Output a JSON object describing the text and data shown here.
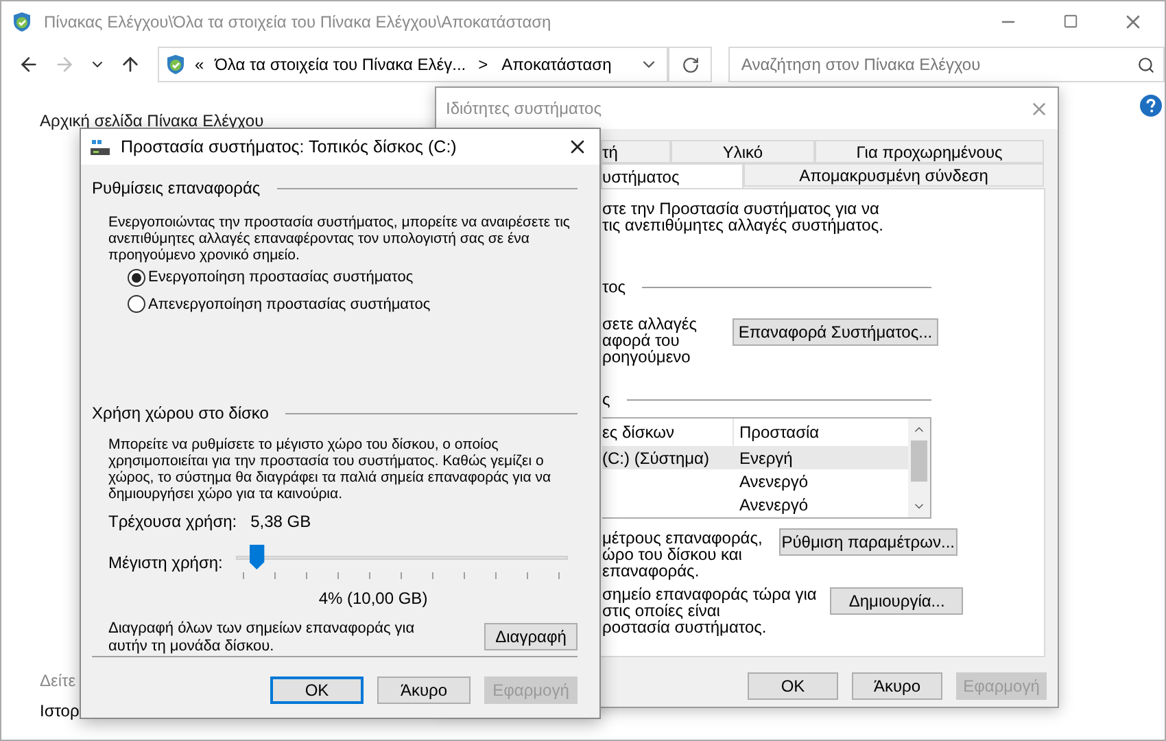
{
  "explorer": {
    "title": "Πίνακας Ελέγχου\\Όλα τα στοιχεία του Πίνακα Ελέγχου\\Αποκατάσταση",
    "nav": [
      {
        "kind": "back",
        "disabled": false
      },
      {
        "kind": "forward",
        "disabled": true
      },
      {
        "kind": "recent",
        "disabled": false
      },
      {
        "kind": "up",
        "disabled": false
      }
    ],
    "address": {
      "overflow": "«",
      "crumbs": [
        "Όλα τα στοιχεία του Πίνακα Ελέγ...",
        "Αποκατάσταση"
      ],
      "separator": ">"
    },
    "search": {
      "placeholder": "Αναζήτηση στον Πίνακα Ελέγχου"
    },
    "sidebar": {
      "home_link": "Αρχική σελίδα Πίνακα Ελέγχου",
      "see_also": "Δείτε",
      "history": "Ιστορ"
    }
  },
  "system_properties": {
    "title": "Ιδιότητες συστήματος",
    "tab_rows": [
      [
        {
          "label": "τή",
          "selected": false
        },
        {
          "label": "Υλικό",
          "selected": false
        },
        {
          "label": "Για προχωρημένους",
          "selected": false
        }
      ],
      [
        {
          "label": "υστήματος",
          "selected": true
        },
        {
          "label": "Απομακρυσμένη σύνδεση",
          "selected": false
        }
      ]
    ],
    "intro": [
      "στε την Προστασία συστήματος για να",
      "τις ανεπιθύμητες αλλαγές συστήματος."
    ],
    "restore_group": "τος",
    "restore_text": [
      "σετε αλλαγές",
      "αφορά του",
      "ροηγούμενο"
    ],
    "restore_button": {
      "label": "Επαναφορά Συστήματος...",
      "disabled": false
    },
    "settings_group": "ς",
    "drives": {
      "columns": [
        "ες δίσκων",
        "Προστασία"
      ],
      "rows": [
        {
          "drive": "(C:) (Σύστημα)",
          "protection": "Ενεργή",
          "selected": true
        },
        {
          "protection": "Ανενεργό",
          "selected": false
        },
        {
          "protection": "Ανενεργό",
          "selected": false
        }
      ]
    },
    "configure_text": [
      "μέτρους επαναφοράς,",
      "ώρο του δίσκου και",
      "επαναφοράς."
    ],
    "configure_button": {
      "label": "Ρύθμιση παραμέτρων...",
      "disabled": false
    },
    "create_text": [
      "σημείο επαναφοράς τώρα για",
      "στις οποίες είναι",
      "ροστασία συστήματος."
    ],
    "create_button": {
      "label": "Δημιουργία...",
      "disabled": false
    },
    "buttons": [
      {
        "label": "OK",
        "disabled": false
      },
      {
        "label": "Άκυρο",
        "disabled": false
      },
      {
        "label": "Εφαρμογή",
        "disabled": true
      }
    ]
  },
  "protection_dialog": {
    "title": "Προστασία συστήματος: Τοπικός δίσκος (C:)",
    "restore_settings": {
      "heading": "Ρυθμίσεις επαναφοράς",
      "text": "Ενεργοποιώντας την προστασία συστήματος, μπορείτε να αναιρέσετε τις ανεπιθύμητες αλλαγές επαναφέροντας τον υπολογιστή σας σε ένα προηγούμενο χρονικό σημείο.",
      "options": [
        {
          "label": "Ενεργοποίηση προστασίας συστήματος",
          "selected": true
        },
        {
          "label": "Απενεργοποίηση προστασίας συστήματος",
          "selected": false
        }
      ]
    },
    "disk_usage": {
      "heading": "Χρήση χώρου στο δίσκο",
      "text": "Μπορείτε να ρυθμίσετε το μέγιστο χώρο του δίσκου, ο οποίος χρησιμοποιείται για την προστασία του συστήματος. Καθώς γεμίζει  ο χώρος, το σύστημα θα διαγράφει τα παλιά σημεία επαναφοράς για να δημιουργήσει χώρο για τα καινούρια.",
      "current_label": "Τρέχουσα χρήση:",
      "current_value": "5,38 GB",
      "max_label": "Μέγιστη χρήση:",
      "max": {
        "level": 0.04
      },
      "max_reading": "4% (10,00 GB)",
      "delete_text": "Διαγραφή όλων των σημείων επαναφοράς για αυτήν τη μονάδα δίσκου.",
      "delete_button": {
        "label": "Διαγραφή",
        "disabled": false
      }
    },
    "buttons": [
      {
        "label": "OK",
        "disabled": false,
        "selected": true
      },
      {
        "label": "Άκυρο",
        "disabled": false,
        "selected": false
      },
      {
        "label": "Εφαρμογή",
        "disabled": true,
        "selected": false
      }
    ]
  }
}
